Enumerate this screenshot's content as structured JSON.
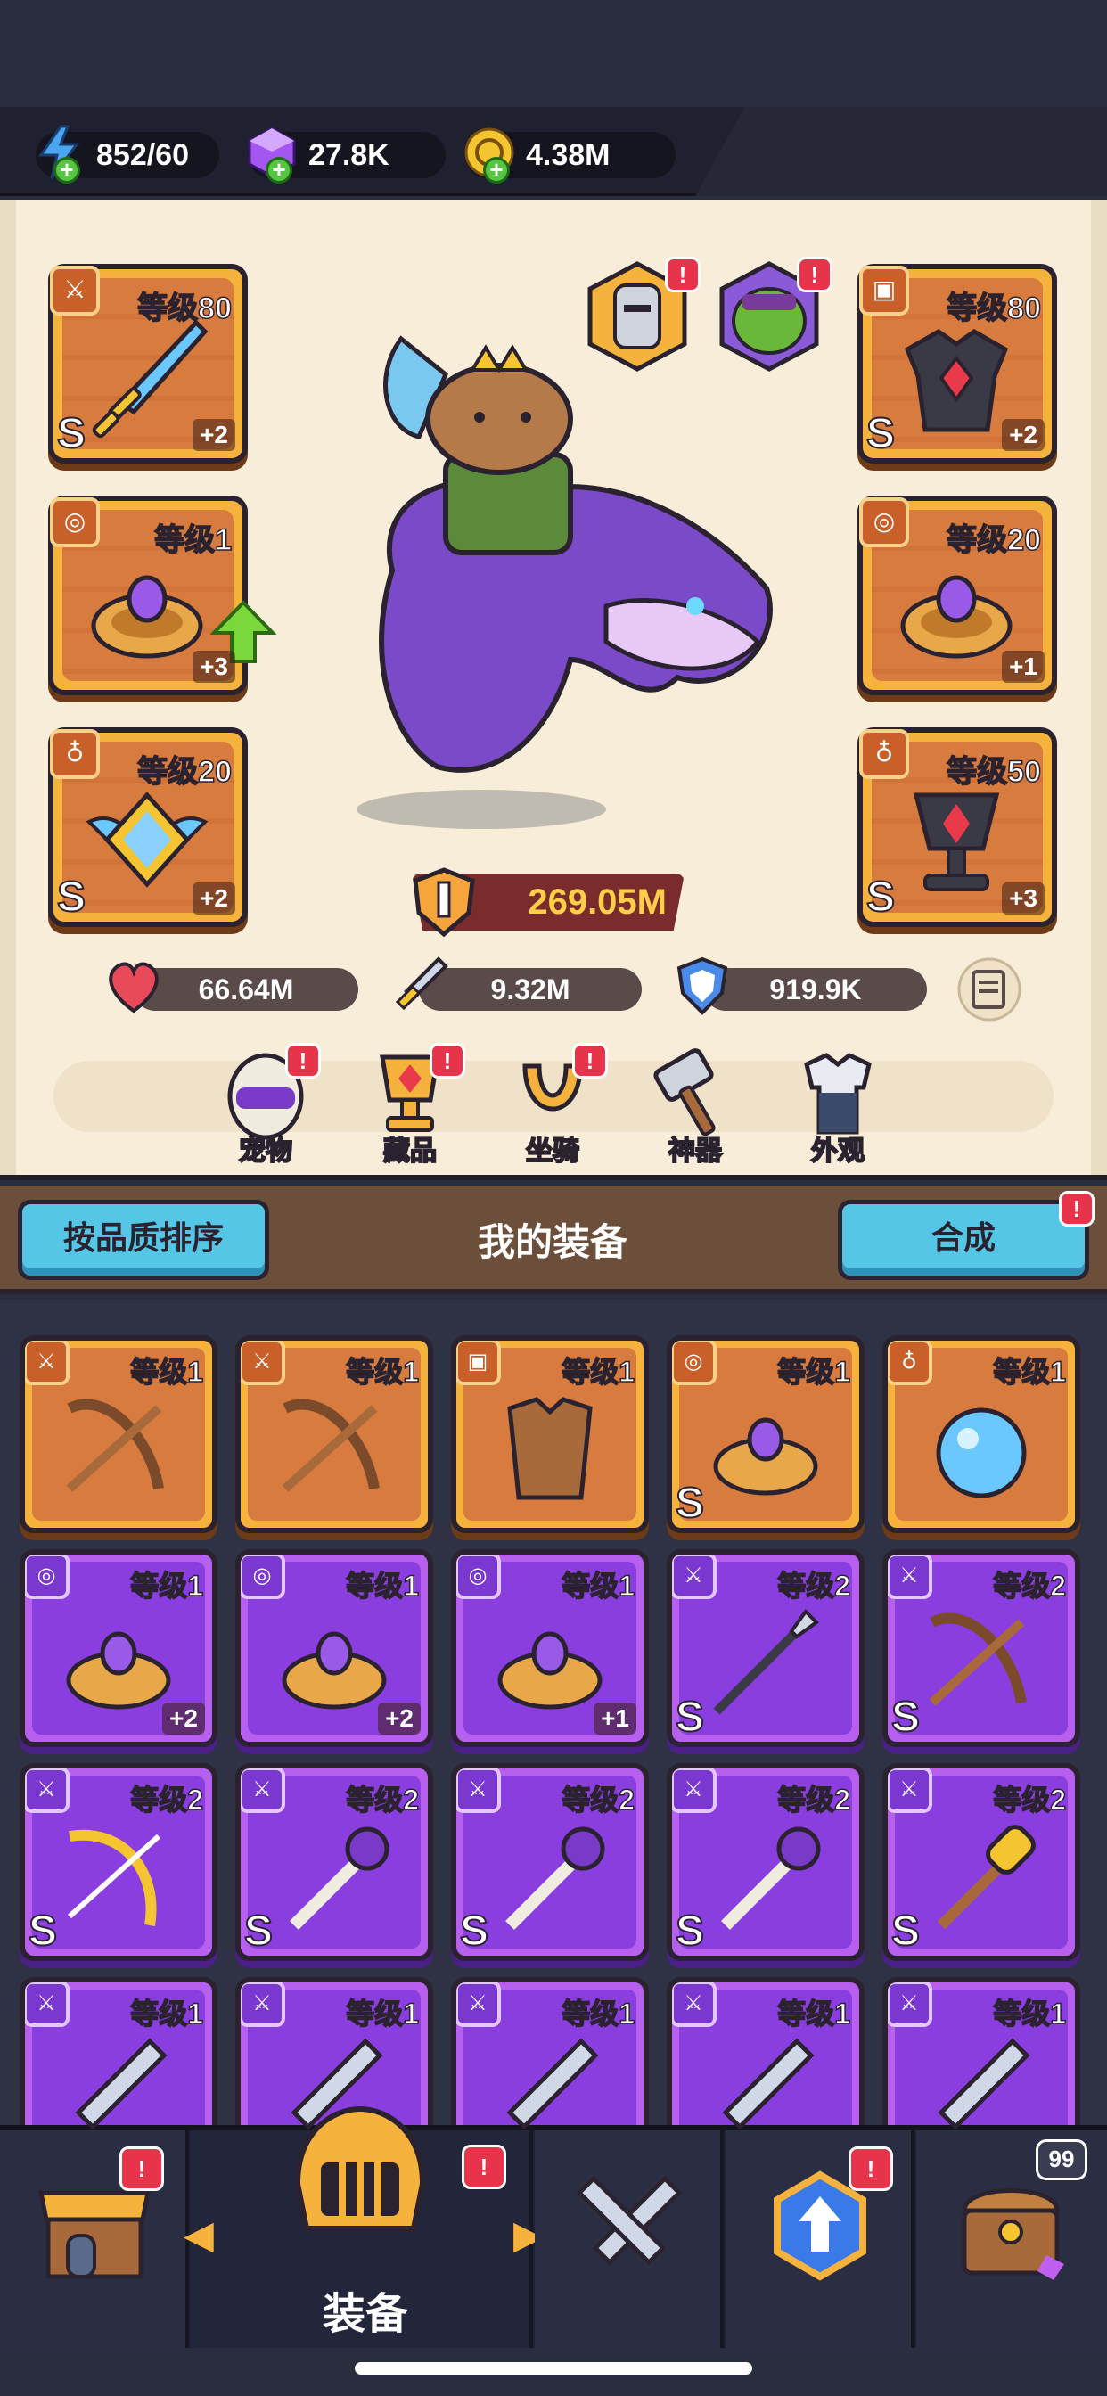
{
  "resources": {
    "energy": "852/60",
    "gems": "27.8K",
    "coins": "4.38M"
  },
  "equipped": {
    "left": [
      {
        "type": "weapon",
        "level": "等级80",
        "plus": "+2",
        "tier": "S"
      },
      {
        "type": "ring",
        "level": "等级1",
        "plus": "+3",
        "tier": ""
      },
      {
        "type": "necklace",
        "level": "等级20",
        "plus": "+2",
        "tier": "S"
      }
    ],
    "right": [
      {
        "type": "armor",
        "level": "等级80",
        "plus": "+2",
        "tier": "S"
      },
      {
        "type": "ring",
        "level": "等级20",
        "plus": "+1",
        "tier": ""
      },
      {
        "type": "necklace",
        "level": "等级50",
        "plus": "+3",
        "tier": "S"
      }
    ]
  },
  "hero": {
    "power": "269.05M",
    "hp": "66.64M",
    "attack": "9.32M",
    "defense": "919.9K"
  },
  "menu": [
    {
      "label": "宠物",
      "badge": "!"
    },
    {
      "label": "藏品",
      "badge": "!"
    },
    {
      "label": "坐骑",
      "badge": "!"
    },
    {
      "label": "神器",
      "badge": ""
    },
    {
      "label": "外观",
      "badge": ""
    }
  ],
  "inventory": {
    "sort_button": "按品质排序",
    "title": "我的装备",
    "merge_button": "合成",
    "merge_badge": "!",
    "rows": [
      [
        {
          "rarity": "orange",
          "level": "等级1",
          "plus": "",
          "tier": "",
          "item": "crossbow"
        },
        {
          "rarity": "orange",
          "level": "等级1",
          "plus": "",
          "tier": "",
          "item": "crossbow"
        },
        {
          "rarity": "orange",
          "level": "等级1",
          "plus": "",
          "tier": "",
          "item": "armor"
        },
        {
          "rarity": "orange",
          "level": "等级1",
          "plus": "",
          "tier": "S",
          "item": "ring"
        },
        {
          "rarity": "orange",
          "level": "等级1",
          "plus": "",
          "tier": "",
          "item": "orb"
        }
      ],
      [
        {
          "rarity": "purple",
          "level": "等级1",
          "plus": "+2",
          "tier": "",
          "item": "ring"
        },
        {
          "rarity": "purple",
          "level": "等级1",
          "plus": "+2",
          "tier": "",
          "item": "ring"
        },
        {
          "rarity": "purple",
          "level": "等级1",
          "plus": "+1",
          "tier": "",
          "item": "ring"
        },
        {
          "rarity": "purple",
          "level": "等级2",
          "plus": "",
          "tier": "S",
          "item": "spear"
        },
        {
          "rarity": "purple",
          "level": "等级2",
          "plus": "",
          "tier": "S",
          "item": "crossbow"
        }
      ],
      [
        {
          "rarity": "purple",
          "level": "等级2",
          "plus": "",
          "tier": "S",
          "item": "bow"
        },
        {
          "rarity": "purple",
          "level": "等级2",
          "plus": "",
          "tier": "S",
          "item": "staff"
        },
        {
          "rarity": "purple",
          "level": "等级2",
          "plus": "",
          "tier": "S",
          "item": "staff"
        },
        {
          "rarity": "purple",
          "level": "等级2",
          "plus": "",
          "tier": "S",
          "item": "staff"
        },
        {
          "rarity": "purple",
          "level": "等级2",
          "plus": "",
          "tier": "S",
          "item": "club"
        }
      ],
      [
        {
          "rarity": "purple",
          "level": "等级1",
          "plus": "",
          "tier": "",
          "item": "sword"
        },
        {
          "rarity": "purple",
          "level": "等级1",
          "plus": "",
          "tier": "",
          "item": "sword"
        },
        {
          "rarity": "purple",
          "level": "等级1",
          "plus": "",
          "tier": "",
          "item": "sword"
        },
        {
          "rarity": "purple",
          "level": "等级1",
          "plus": "",
          "tier": "",
          "item": "sword"
        },
        {
          "rarity": "purple",
          "level": "等级1",
          "plus": "",
          "tier": "",
          "item": "sword"
        }
      ]
    ]
  },
  "nav": {
    "active_label": "装备",
    "chest_count": "99",
    "badge": "!"
  },
  "colors": {
    "orange_slot": "#f5b23c",
    "purple_slot": "#b760f0",
    "accent_blue": "#55c6e6",
    "badge_red": "#e8344a"
  }
}
